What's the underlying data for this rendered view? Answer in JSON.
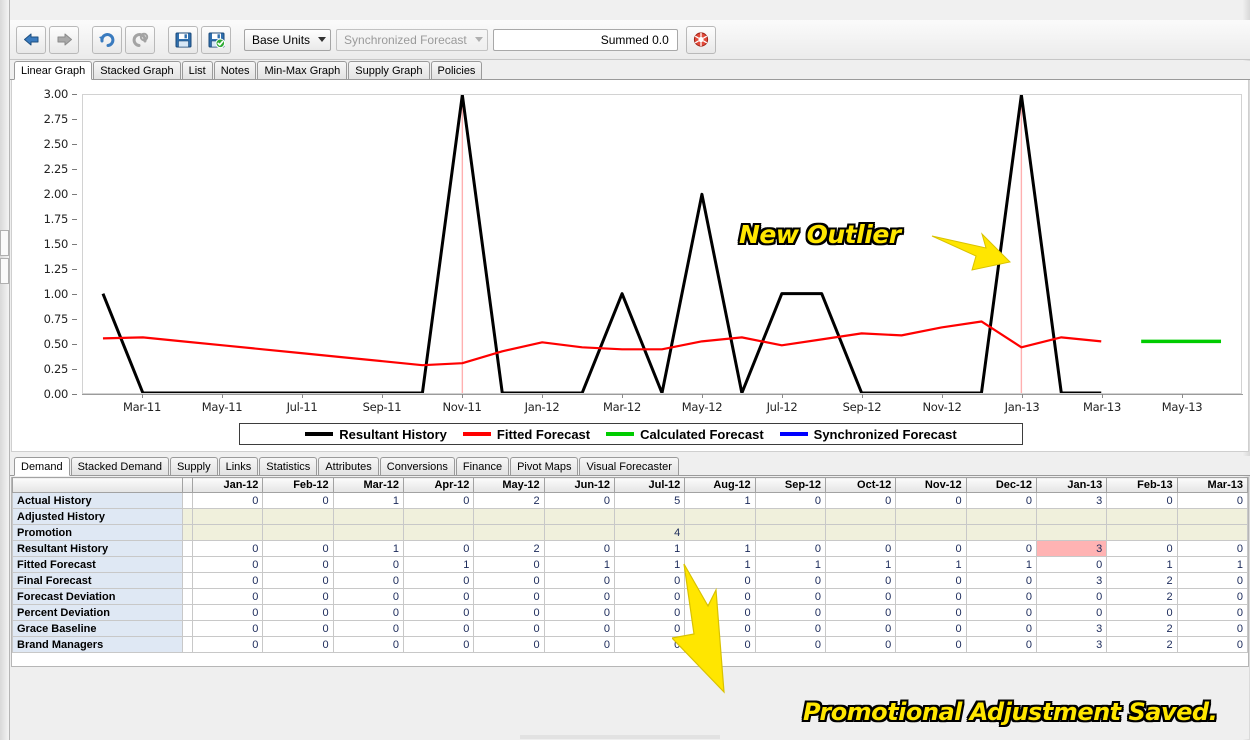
{
  "toolbar": {
    "back_icon": "back-arrow-icon",
    "forward_icon": "forward-arrow-icon",
    "undo_icon": "undo-icon",
    "redo_icon": "redo-icon",
    "save_icon": "save-icon",
    "save_validate_icon": "save-validate-icon",
    "refresh_icon": "refresh-icon",
    "units_combo": "Base Units",
    "forecast_combo": "Synchronized Forecast",
    "summed_value": "Summed 0.0"
  },
  "top_tabs": [
    {
      "label": "Linear Graph",
      "active": true
    },
    {
      "label": "Stacked Graph",
      "active": false
    },
    {
      "label": "List",
      "active": false
    },
    {
      "label": "Notes",
      "active": false
    },
    {
      "label": "Min-Max Graph",
      "active": false
    },
    {
      "label": "Supply Graph",
      "active": false
    },
    {
      "label": "Policies",
      "active": false
    }
  ],
  "bottom_tabs": [
    {
      "label": "Demand",
      "active": true
    },
    {
      "label": "Stacked Demand",
      "active": false
    },
    {
      "label": "Supply",
      "active": false
    },
    {
      "label": "Links",
      "active": false
    },
    {
      "label": "Statistics",
      "active": false
    },
    {
      "label": "Attributes",
      "active": false
    },
    {
      "label": "Conversions",
      "active": false
    },
    {
      "label": "Finance",
      "active": false
    },
    {
      "label": "Pivot Maps",
      "active": false
    },
    {
      "label": "Visual Forecaster",
      "active": false
    }
  ],
  "annotations": [
    {
      "text": "New Outlier",
      "name": "annotation-new-outlier"
    },
    {
      "text": "Promotional Adjustment Saved.",
      "name": "annotation-promotional-adjustment-saved"
    }
  ],
  "chart_data": {
    "type": "line",
    "title": "",
    "xlabel": "",
    "ylabel": "",
    "ylim": [
      0,
      3
    ],
    "yticks": [
      "0.00",
      "0.25",
      "0.50",
      "0.75",
      "1.00",
      "1.25",
      "1.50",
      "1.75",
      "2.00",
      "2.25",
      "2.50",
      "2.75",
      "3.00"
    ],
    "xtick_labels": [
      "Mar-11",
      "May-11",
      "Jul-11",
      "Sep-11",
      "Nov-11",
      "Jan-12",
      "Mar-12",
      "May-12",
      "Jul-12",
      "Sep-12",
      "Nov-12",
      "Jan-13",
      "Mar-13",
      "May-13"
    ],
    "x": [
      "Feb-11",
      "Mar-11",
      "Apr-11",
      "May-11",
      "Jun-11",
      "Jul-11",
      "Aug-11",
      "Sep-11",
      "Oct-11",
      "Nov-11",
      "Dec-11",
      "Jan-12",
      "Feb-12",
      "Mar-12",
      "Apr-12",
      "May-12",
      "Jun-12",
      "Jul-12",
      "Aug-12",
      "Sep-12",
      "Oct-12",
      "Nov-12",
      "Dec-12",
      "Jan-13",
      "Feb-13",
      "Mar-13",
      "Apr-13",
      "May-13",
      "Jun-13"
    ],
    "grid": false,
    "legend_position": "bottom",
    "series": [
      {
        "name": "Resultant History",
        "color": "#000000",
        "values": [
          1,
          0,
          0,
          0,
          0,
          0,
          0,
          0,
          0,
          3,
          0,
          0,
          0,
          1,
          0,
          2,
          0,
          1,
          1,
          0,
          0,
          0,
          0,
          3,
          0,
          0,
          null,
          null,
          null
        ]
      },
      {
        "name": "Fitted Forecast",
        "color": "#ff0000",
        "values": [
          0.55,
          0.56,
          0.52,
          0.48,
          0.44,
          0.4,
          0.36,
          0.32,
          0.28,
          0.3,
          0.42,
          0.51,
          0.46,
          0.44,
          0.44,
          0.52,
          0.56,
          0.48,
          0.54,
          0.6,
          0.58,
          0.66,
          0.72,
          0.46,
          0.56,
          0.52,
          null,
          null,
          null
        ]
      },
      {
        "name": "Calculated Forecast",
        "color": "#00cc00",
        "values": [
          null,
          null,
          null,
          null,
          null,
          null,
          null,
          null,
          null,
          null,
          null,
          null,
          null,
          null,
          null,
          null,
          null,
          null,
          null,
          null,
          null,
          null,
          null,
          null,
          null,
          null,
          0.52,
          0.52,
          0.52
        ]
      },
      {
        "name": "Synchronized Forecast",
        "color": "#0000ff",
        "values": []
      }
    ],
    "vertical_markers": [
      "Nov-11",
      "Jan-13"
    ],
    "marker_color": "#ffb0b0"
  },
  "grid": {
    "columns": [
      "Jan-12",
      "Feb-12",
      "Mar-12",
      "Apr-12",
      "May-12",
      "Jun-12",
      "Jul-12",
      "Aug-12",
      "Sep-12",
      "Oct-12",
      "Nov-12",
      "Dec-12",
      "Jan-13",
      "Feb-13",
      "Mar-13"
    ],
    "rows": [
      {
        "label": "Actual History",
        "values": [
          "0",
          "0",
          "1",
          "0",
          "2",
          "0",
          "5",
          "1",
          "0",
          "0",
          "0",
          "0",
          "3",
          "0",
          "0"
        ],
        "style": "readonly"
      },
      {
        "label": "Adjusted History",
        "values": [
          "",
          "",
          "",
          "",
          "",
          "",
          "",
          "",
          "",
          "",
          "",
          "",
          "",
          "",
          ""
        ],
        "style": "editable"
      },
      {
        "label": "Promotion",
        "values": [
          "",
          "",
          "",
          "",
          "",
          "",
          "4",
          "",
          "",
          "",
          "",
          "",
          "",
          "",
          ""
        ],
        "style": "editable"
      },
      {
        "label": "Resultant History",
        "values": [
          "0",
          "0",
          "1",
          "0",
          "2",
          "0",
          "1",
          "1",
          "0",
          "0",
          "0",
          "0",
          "3",
          "0",
          "0"
        ],
        "style": "readonly",
        "highlight_index": 12
      },
      {
        "label": "Fitted Forecast",
        "values": [
          "0",
          "0",
          "0",
          "1",
          "0",
          "1",
          "1",
          "1",
          "1",
          "1",
          "1",
          "1",
          "0",
          "1",
          "1"
        ],
        "style": "readonly"
      },
      {
        "label": "Final Forecast",
        "values": [
          "0",
          "0",
          "0",
          "0",
          "0",
          "0",
          "0",
          "0",
          "0",
          "0",
          "0",
          "0",
          "3",
          "2",
          "0"
        ],
        "style": "readonly"
      },
      {
        "label": "Forecast Deviation",
        "values": [
          "0",
          "0",
          "0",
          "0",
          "0",
          "0",
          "0",
          "0",
          "0",
          "0",
          "0",
          "0",
          "0",
          "2",
          "0"
        ],
        "style": "readonly"
      },
      {
        "label": "Percent Deviation",
        "values": [
          "0",
          "0",
          "0",
          "0",
          "0",
          "0",
          "0",
          "0",
          "0",
          "0",
          "0",
          "0",
          "0",
          "0",
          "0"
        ],
        "style": "readonly"
      },
      {
        "label": "Grace Baseline",
        "values": [
          "0",
          "0",
          "0",
          "0",
          "0",
          "0",
          "0",
          "0",
          "0",
          "0",
          "0",
          "0",
          "3",
          "2",
          "0"
        ],
        "style": "readonly"
      },
      {
        "label": "Brand Managers",
        "values": [
          "0",
          "0",
          "0",
          "0",
          "0",
          "0",
          "0",
          "0",
          "0",
          "0",
          "0",
          "0",
          "3",
          "2",
          "0"
        ],
        "style": "readonly"
      }
    ]
  }
}
